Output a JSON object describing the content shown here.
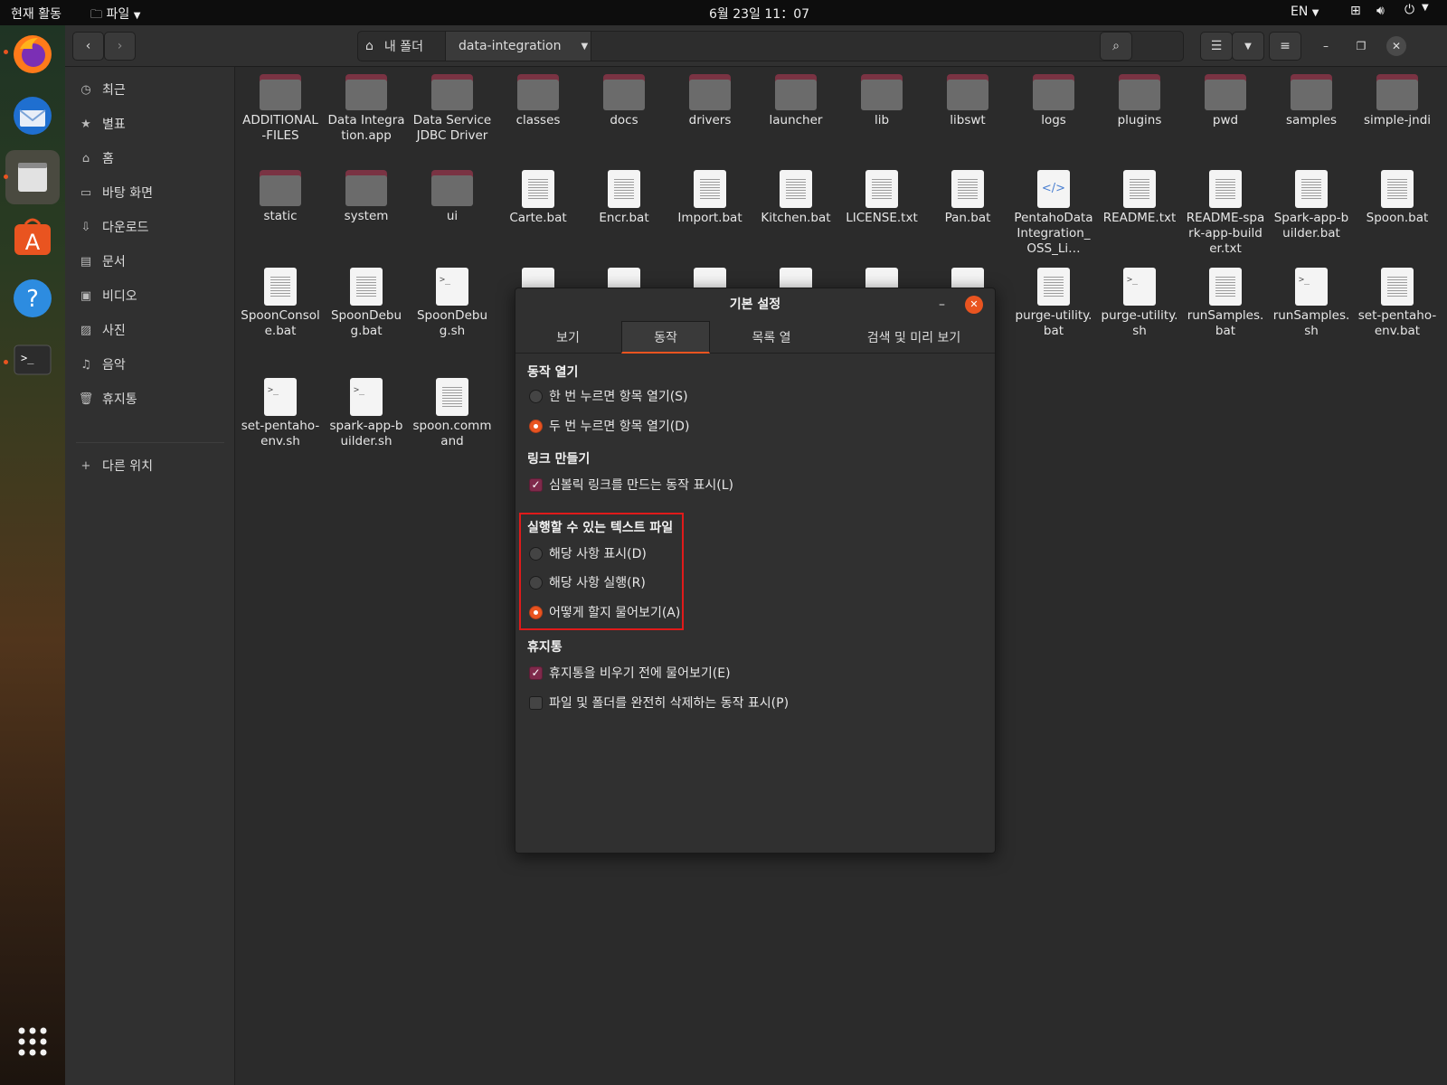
{
  "topbar": {
    "activities": "현재 활동",
    "app_menu": "파일",
    "clock": "6월 23일  11：07",
    "lang": "EN"
  },
  "dock": {
    "apps": [
      "firefox-icon",
      "thunderbird-icon",
      "files-icon",
      "app-center-icon",
      "help-icon",
      "terminal-icon"
    ],
    "show_apps": "show-apps-icon"
  },
  "header": {
    "home": "내 폴더",
    "folder": "data-integration"
  },
  "sidebar": {
    "items": [
      {
        "label": "최근",
        "icon": "clock-icon"
      },
      {
        "label": "별표",
        "icon": "star-icon"
      },
      {
        "label": "홈",
        "icon": "home-icon"
      },
      {
        "label": "바탕 화면",
        "icon": "desktop-icon"
      },
      {
        "label": "다운로드",
        "icon": "download-icon"
      },
      {
        "label": "문서",
        "icon": "document-icon"
      },
      {
        "label": "비디오",
        "icon": "video-icon"
      },
      {
        "label": "사진",
        "icon": "picture-icon"
      },
      {
        "label": "음악",
        "icon": "music-icon"
      },
      {
        "label": "휴지통",
        "icon": "trash-icon"
      }
    ],
    "other": "다른 위치"
  },
  "files": {
    "row1": [
      "ADDITIONAL-FILES",
      "Data Integration.app",
      "Data Service JDBC Driver",
      "classes",
      "docs",
      "drivers",
      "launcher",
      "lib",
      "libswt",
      "logs",
      "plugins",
      "pwd",
      "samples",
      "simple-jndi"
    ],
    "row2": [
      "static",
      "system",
      "ui",
      "Carte.bat",
      "Encr.bat",
      "Import.bat",
      "Kitchen.bat",
      "LICENSE.txt",
      "Pan.bat",
      "PentahoDataIntegration_OSS_Li…",
      "README.txt",
      "README-spark-app-builder.txt",
      "Spark-app-builder.bat",
      "Spoon.bat"
    ],
    "row3": [
      "SpoonConsole.bat",
      "SpoonDebug.bat",
      "SpoonDebug.sh",
      "purge-utility.bat",
      "purge-utility.sh",
      "runSamples.bat",
      "runSamples.sh",
      "set-pentaho-env.bat"
    ],
    "row4": [
      "set-pentaho-env.sh",
      "spark-app-builder.sh",
      "spoon.command"
    ]
  },
  "dialog": {
    "title": "기본 설정",
    "tabs": [
      "보기",
      "동작",
      "목록 열",
      "검색 및 미리 보기"
    ],
    "open_section": "동작 열기",
    "single_click": "한 번 누르면 항목 열기(S)",
    "double_click": "두 번 누르면 항목 열기(D)",
    "link_section": "링크 만들기",
    "symlink": "심볼릭 링크를 만드는 동작 표시(L)",
    "exec_section": "실행할 수 있는 텍스트 파일",
    "exec_show": "해당 사항 표시(D)",
    "exec_run": "해당 사항 실행(R)",
    "exec_ask": "어떻게 할지 물어보기(A)",
    "trash_section": "휴지통",
    "trash_ask": "휴지통을 비우기 전에 물어보기(E)",
    "trash_delete": "파일 및 폴더를 완전히 삭제하는 동작 표시(P)"
  },
  "colors": {
    "accent": "#e95420",
    "highlight": "#e01a1a",
    "checkbox": "#7f2a4b"
  }
}
